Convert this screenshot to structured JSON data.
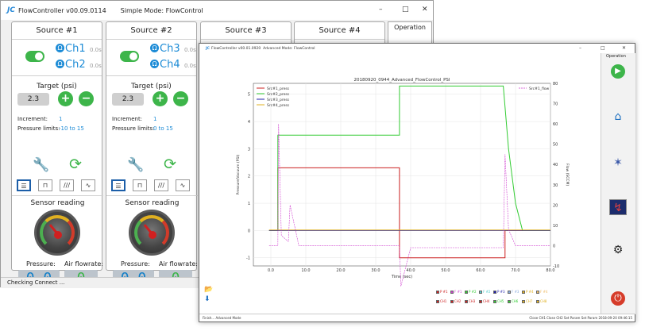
{
  "win1": {
    "app_title": "FlowController v00.09.0114",
    "mode_title": "Simple Mode: FlowControl",
    "minimize": "–",
    "maximize": "□",
    "close": "✕",
    "status": "Checking Connect ...",
    "operation_label": "Operation",
    "sources": [
      {
        "title": "Source #1",
        "ch_a": "Ch1",
        "ch_b": "Ch2",
        "time_a": "0.0s",
        "time_b": "0.0s",
        "target_label": "Target (psi)",
        "target_value": "2.3",
        "increment_label": "Increment:",
        "increment_value": "1",
        "limits_label": "Pressure limits:",
        "limits_value": "-10 to 15",
        "sensor_label": "Sensor reading",
        "pressure_label": "Pressure:",
        "airflow_label": "Air flowrate:",
        "pressure_lcd": "0.0",
        "airflow_lcd": "0"
      },
      {
        "title": "Source #2",
        "ch_a": "Ch3",
        "ch_b": "Ch4",
        "time_a": "0.0s",
        "time_b": "0.0s",
        "target_label": "Target (psi)",
        "target_value": "2.3",
        "increment_label": "Increment:",
        "increment_value": "1",
        "limits_label": "Pressure limits:",
        "limits_value": "0 to 15",
        "sensor_label": "Sensor reading",
        "pressure_label": "Pressure:",
        "airflow_label": "Air flowrate:",
        "pressure_lcd": "0.0",
        "airflow_lcd": "0"
      },
      {
        "title": "Source #3"
      },
      {
        "title": "Source #4"
      }
    ]
  },
  "win2": {
    "app_title": "FlowController v00.01.0920",
    "mode_title": "Advanced Mode: FlowControl",
    "operation_label": "Operation",
    "status_left": "Finish... Advanced Mode",
    "status_right": "Close CH1  Close CH2  Set Param  Set Param        2018-09-20 09:46:15"
  },
  "chart_data": {
    "type": "line",
    "title": "20180920_0944_Advanced_FlowControl_PSI",
    "xlabel": "Time (sec)",
    "ylabel": "Pressure/Vacuum (PSI)",
    "y2label": "Flow (SCCM)",
    "xlim": [
      -5,
      80
    ],
    "ylim": [
      -1.3,
      5.4
    ],
    "y2lim": [
      -10,
      80
    ],
    "xticks": [
      "0.0",
      "10.0",
      "20.0",
      "30.0",
      "40.0",
      "50.0",
      "60.0",
      "70.0",
      "80.0"
    ],
    "yticks": [
      "-1",
      "0",
      "1",
      "2",
      "3",
      "4",
      "5"
    ],
    "y2ticks": [
      "-10",
      "0",
      "10",
      "20",
      "30",
      "40",
      "50",
      "60",
      "70",
      "80"
    ],
    "grid": true,
    "legend_left": [
      "Src#1_press",
      "Src#2_press",
      "Src#3_press",
      "Src#4_press"
    ],
    "legend_right": [
      "Src#1_flow"
    ],
    "series": [
      {
        "name": "Src#1_press",
        "color": "#cc2020",
        "axis": "left",
        "x": [
          -0.5,
          2,
          2,
          36.8,
          36.8,
          67,
          67,
          80
        ],
        "y": [
          0,
          0,
          2.3,
          2.3,
          -1.0,
          -1.0,
          0,
          0
        ]
      },
      {
        "name": "Src#2_press",
        "color": "#33cc33",
        "axis": "left",
        "x": [
          -0.5,
          2,
          2,
          36.8,
          36.8,
          66.5,
          68,
          70,
          72,
          80
        ],
        "y": [
          0,
          0,
          3.5,
          3.5,
          5.3,
          5.3,
          3.0,
          1.0,
          0,
          0
        ]
      },
      {
        "name": "Src#3_press",
        "color": "#2222aa",
        "axis": "left",
        "x": [
          -0.5,
          80
        ],
        "y": [
          0,
          0
        ]
      },
      {
        "name": "Src#4_press",
        "color": "#e0b020",
        "axis": "left",
        "x": [
          -0.5,
          80
        ],
        "y": [
          0.02,
          0.02
        ]
      },
      {
        "name": "Src#1_flow",
        "color": "#d040d0",
        "axis": "right",
        "x": [
          -0.5,
          2,
          2.2,
          3,
          5,
          5.5,
          8,
          36.8,
          37.2,
          40,
          66.5,
          67,
          68,
          70,
          80
        ],
        "y": [
          0,
          0,
          60,
          5,
          2,
          20,
          0,
          0,
          -20,
          -1,
          -1,
          45,
          8,
          0,
          0
        ]
      }
    ]
  },
  "legend_rows": {
    "row1": [
      "P #1",
      "F #1",
      "P #2",
      "F #2",
      "P #3",
      "F #3",
      "P #4",
      "F #4"
    ],
    "row2": [
      "CH1",
      "CH2",
      "CH3",
      "CH4",
      "CH5",
      "CH6",
      "CH7",
      "CH8"
    ],
    "colors1": [
      "#cc2020",
      "#d040d0",
      "#33cc33",
      "#5cc",
      "#2222aa",
      "#8ad",
      "#e0b020",
      "#eb6"
    ],
    "colors2": [
      "#cc2020",
      "#cc2020",
      "#cc2020",
      "#cc2020",
      "#33cc33",
      "#33cc33",
      "#e0b020",
      "#e0b020"
    ]
  },
  "icons": {
    "play": "▶",
    "home": "⌂",
    "cross": "✶",
    "graph": "↯",
    "gear": "⚙",
    "power": "⏻",
    "folder": "📂",
    "download": "⬇",
    "wrench": "🔧",
    "refresh": "⟳"
  }
}
